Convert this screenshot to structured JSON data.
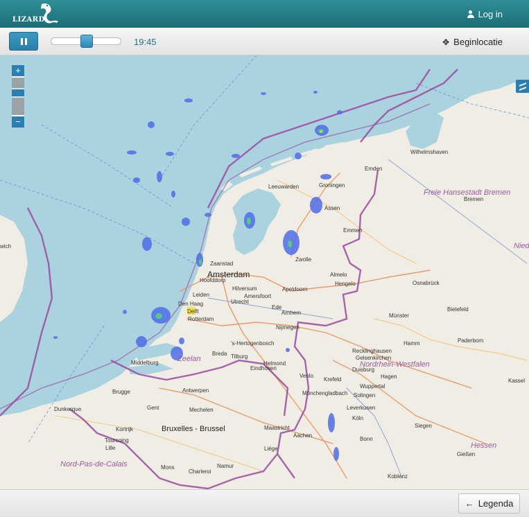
{
  "app": {
    "logo_text": "LIZARD"
  },
  "header": {
    "login_label": "Log in"
  },
  "toolbar": {
    "time": "19:45",
    "timeline_position": 0.51,
    "beginlocatie_label": "Beginlocatie"
  },
  "map": {
    "zoom_in_label": "+",
    "zoom_out_label": "−",
    "zoom_level_fraction": 0.42,
    "places": {
      "amsterdam": "Amsterdam",
      "zaanstad": "Zaanstad",
      "hoofddorp": "Hoofddorp",
      "hilversum": "Hilversum",
      "amersfoort": "Amersfoort",
      "apeldoorn": "Apeldoorn",
      "leiden": "Leiden",
      "den_haag": "Den Haag",
      "delft": "Delft",
      "rotterdam": "Rotterdam",
      "utrecht": "Utrecht",
      "ede": "Ede",
      "arnhem": "Arnhem",
      "nijmegen": "Nijmegen",
      "den_bosch": "'s-Hertogenbosch",
      "tilburg": "Tilburg",
      "breda": "Breda",
      "eindhoven": "Eindhoven",
      "helmond": "Helmond",
      "venlo": "Venlo",
      "middelburg": "Middelburg",
      "leeuwarden": "Leeuwarden",
      "groningen": "Groningen",
      "assen": "Assen",
      "emmen": "Emmen",
      "zwolle": "Zwolle",
      "almelo": "Almelo",
      "hengelo": "Hengelo",
      "emden": "Emden",
      "wilhelmshaven": "Wilhelmshaven",
      "bremen": "Bremen",
      "osnabruck": "Osnabrück",
      "bielefeld": "Bielefeld",
      "munster": "Münster",
      "hamm": "Hamm",
      "paderborn": "Paderborn",
      "recklinghausen": "Recklinghausen",
      "gelsenkirchen": "Gelsenkirchen",
      "hagen": "Hagen",
      "krefeld": "Krefeld",
      "duisburg": "Duisburg",
      "wuppertal": "Wuppertal",
      "solingen": "Solingen",
      "monchengladbach": "Mönchengladbach",
      "leverkusen": "Leverkusen",
      "koln": "Köln",
      "bonn": "Bonn",
      "aachen": "Aachen",
      "siegen": "Siegen",
      "giessen": "Gießen",
      "koblenz": "Koblenz",
      "kassel": "Kassel",
      "brugge": "Brugge",
      "gent": "Gent",
      "antwerpen": "Antwerpen",
      "mechelen": "Mechelen",
      "bruxelles": "Bruxelles - Brussel",
      "maastricht": "Maastricht",
      "liege": "Liège",
      "namur": "Namur",
      "charleroi": "Charleroi",
      "mons": "Mons",
      "lille": "Lille",
      "kortrijk": "Kortrijk",
      "tourcoing": "Tourcoing",
      "dunkerque": "Dunkerque",
      "norwich": "wich"
    },
    "regions": {
      "bremen_state": "Freie Hansestadt Bremen",
      "nrw": "Nordrhein-Westfalen",
      "hessen": "Hessen",
      "nord_pas_de_calais": "Nord-Pas-de-Calais",
      "nieder": "Nieder",
      "zeeland": "Zeelan"
    }
  },
  "footer": {
    "legenda_label": "Legenda"
  },
  "colors": {
    "header": "#1f7079",
    "accent": "#2b7fb0",
    "sea": "#aad3df",
    "land": "#f0ede4"
  }
}
